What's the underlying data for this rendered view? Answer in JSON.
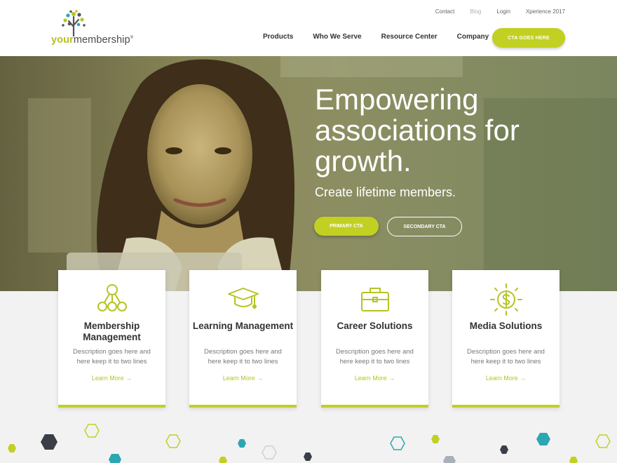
{
  "brand": {
    "logo_your": "your",
    "logo_membership": "membership",
    "logo_mark": "®",
    "accent": "#c1d022"
  },
  "utility_nav": [
    "Contact",
    "Blog",
    "Login",
    "Xperience 2017"
  ],
  "main_nav": [
    "Products",
    "Who We Serve",
    "Resource Center",
    "Company"
  ],
  "header_cta": "CTA GOES HERE",
  "hero": {
    "title": "Empowering associations for growth.",
    "subtitle": "Create lifetime members.",
    "primary_cta": "PRIMARY CTA",
    "secondary_cta": "SECONDARY CTA"
  },
  "cards": [
    {
      "icon": "membership-network-icon",
      "title": "Membership Management",
      "desc": "Description goes here and here keep it to two lines",
      "link": "Learn More →"
    },
    {
      "icon": "graduation-cap-icon",
      "title": "Learning Management",
      "desc": "Description goes here and here keep it to two lines",
      "link": "Learn More →"
    },
    {
      "icon": "briefcase-icon",
      "title": "Career Solutions",
      "desc": "Description goes here and here keep it to two lines",
      "link": "Learn More →"
    },
    {
      "icon": "dollar-sign-icon",
      "title": "Media Solutions",
      "desc": "Description goes here and here keep it to two lines",
      "link": "Learn More →"
    }
  ]
}
